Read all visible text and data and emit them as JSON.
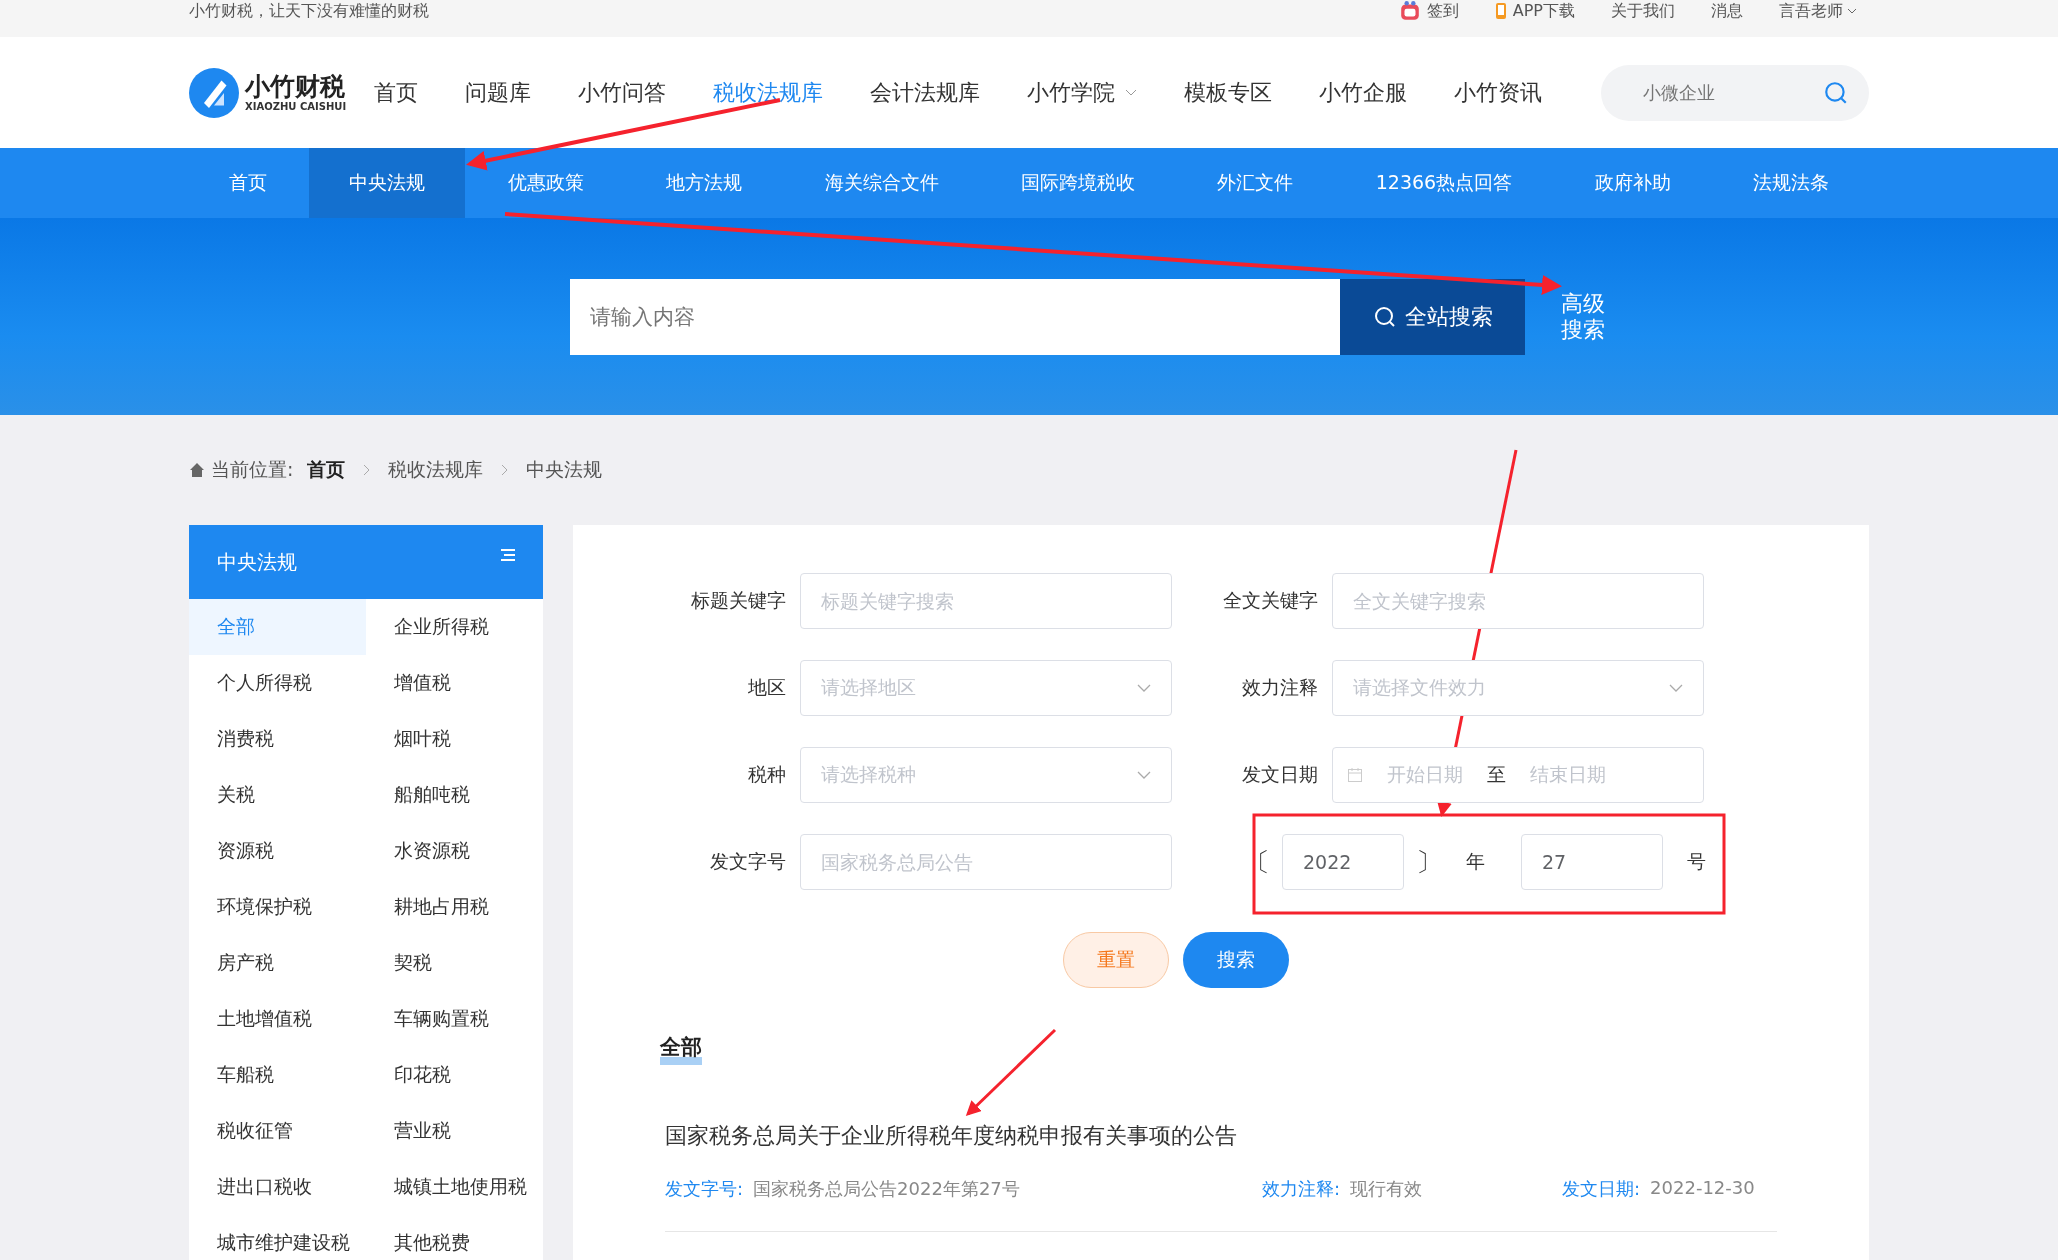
{
  "top_bar": {
    "slogan": "小竹财税，让天下没有难懂的财税",
    "links": [
      {
        "kind": "checkin",
        "label": "签到"
      },
      {
        "kind": "app",
        "label": "APP下载"
      },
      {
        "kind": "plain",
        "label": "关于我们"
      },
      {
        "kind": "plain",
        "label": "消息"
      },
      {
        "kind": "user",
        "label": "言吾老师"
      }
    ]
  },
  "header": {
    "logo": {
      "name": "小竹财税",
      "subtitle": "XIAOZHU CAISHUI"
    },
    "nav": [
      {
        "label": "首页",
        "selected": false,
        "dropdown": false
      },
      {
        "label": "问题库",
        "selected": false,
        "dropdown": false
      },
      {
        "label": "小竹问答",
        "selected": false,
        "dropdown": false
      },
      {
        "label": "税收法规库",
        "selected": true,
        "dropdown": false
      },
      {
        "label": "会计法规库",
        "selected": false,
        "dropdown": false
      },
      {
        "label": "小竹学院",
        "selected": false,
        "dropdown": true
      },
      {
        "label": "模板专区",
        "selected": false,
        "dropdown": false
      },
      {
        "label": "小竹企服",
        "selected": false,
        "dropdown": false
      },
      {
        "label": "小竹资讯",
        "selected": false,
        "dropdown": false
      }
    ],
    "search": {
      "placeholder": "小微企业"
    }
  },
  "sub_nav": [
    {
      "label": "首页",
      "selected": false
    },
    {
      "label": "中央法规",
      "selected": true
    },
    {
      "label": "优惠政策",
      "selected": false
    },
    {
      "label": "地方法规",
      "selected": false
    },
    {
      "label": "海关综合文件",
      "selected": false
    },
    {
      "label": "国际跨境税收",
      "selected": false
    },
    {
      "label": "外汇文件",
      "selected": false
    },
    {
      "label": "12366热点回答",
      "selected": false
    },
    {
      "label": "政府补助",
      "selected": false
    },
    {
      "label": "法规法条",
      "selected": false
    }
  ],
  "banner": {
    "search_placeholder": "请输入内容",
    "search_button": "全站搜索",
    "advanced_search": "高级搜索"
  },
  "breadcrumb": {
    "prefix": "当前位置:",
    "items": [
      "首页",
      "税收法规库",
      "中央法规"
    ]
  },
  "sidebar": {
    "title": "中央法规",
    "items": [
      {
        "label": "全部",
        "selected": true
      },
      {
        "label": "企业所得税",
        "selected": false
      },
      {
        "label": "个人所得税",
        "selected": false
      },
      {
        "label": "增值税",
        "selected": false
      },
      {
        "label": "消费税",
        "selected": false
      },
      {
        "label": "烟叶税",
        "selected": false
      },
      {
        "label": "关税",
        "selected": false
      },
      {
        "label": "船舶吨税",
        "selected": false
      },
      {
        "label": "资源税",
        "selected": false
      },
      {
        "label": "水资源税",
        "selected": false
      },
      {
        "label": "环境保护税",
        "selected": false
      },
      {
        "label": "耕地占用税",
        "selected": false
      },
      {
        "label": "房产税",
        "selected": false
      },
      {
        "label": "契税",
        "selected": false
      },
      {
        "label": "土地增值税",
        "selected": false
      },
      {
        "label": "车辆购置税",
        "selected": false
      },
      {
        "label": "车船税",
        "selected": false
      },
      {
        "label": "印花税",
        "selected": false
      },
      {
        "label": "税收征管",
        "selected": false
      },
      {
        "label": "营业税",
        "selected": false
      },
      {
        "label": "进出口税收",
        "selected": false
      },
      {
        "label": "城镇土地使用税",
        "selected": false
      },
      {
        "label": "城市维护建设税",
        "selected": false
      },
      {
        "label": "其他税费",
        "selected": false
      }
    ]
  },
  "search_form": {
    "fields": [
      {
        "kind": "text",
        "label": "标题关键字",
        "placeholder": "标题关键字搜索"
      },
      {
        "kind": "text",
        "label": "全文关键字",
        "placeholder": "全文关键字搜索"
      },
      {
        "kind": "select",
        "label": "地区",
        "placeholder": "请选择地区"
      },
      {
        "kind": "select",
        "label": "效力注释",
        "placeholder": "请选择文件效力"
      },
      {
        "kind": "select",
        "label": "税种",
        "placeholder": "请选择税种"
      },
      {
        "kind": "daterange",
        "label": "发文日期",
        "start_placeholder": "开始日期",
        "separator": "至",
        "end_placeholder": "结束日期"
      },
      {
        "kind": "text",
        "label": "发文字号",
        "placeholder": "国家税务总局公告"
      },
      {
        "kind": "docnumber",
        "open_bracket": "〔",
        "year": "2022",
        "close_bracket": "〕",
        "year_label": "年",
        "number": "27",
        "number_label": "号"
      }
    ],
    "buttons": [
      {
        "kind": "reset",
        "label": "重置"
      },
      {
        "kind": "search",
        "label": "搜索"
      }
    ]
  },
  "results": {
    "tab": "全部",
    "items": [
      {
        "title": "国家税务总局关于企业所得税年度纳税申报有关事项的公告",
        "meta": [
          {
            "label": "发文字号:",
            "value": "国家税务总局公告2022年第27号"
          },
          {
            "label": "效力注释:",
            "value": "现行有效"
          },
          {
            "label": "发文日期:",
            "value": "2022-12-30"
          }
        ]
      }
    ]
  }
}
